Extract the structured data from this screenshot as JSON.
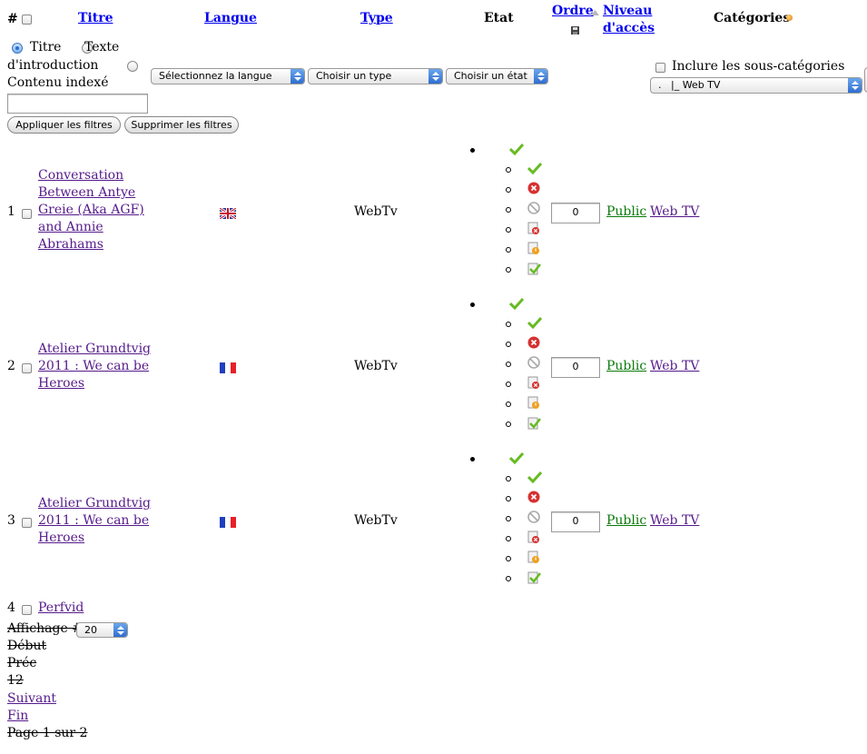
{
  "header": {
    "hash": "#",
    "titre": "Titre",
    "langue": "Langue",
    "type": "Type",
    "etat": "Etat",
    "ordre": "Ordre",
    "niveau_line1": "Niveau",
    "niveau_line2": "d'accès",
    "categories": "Catégories"
  },
  "filters": {
    "radio_titre": "Titre",
    "radio_texte_1": "Texte",
    "radio_texte_2": "d'introduction",
    "radio_contenu": "Contenu indexé",
    "search_value": "",
    "select_langue": "Sélectionnez la langue",
    "select_type": "Choisir un type",
    "select_etat": "Choisir un état",
    "include_sub": "Inclure les sous-catégories",
    "select_category": ".   |_ Web TV",
    "apply_label": "Appliquer les filtres",
    "clear_label": "Supprimer les filtres"
  },
  "rows": [
    {
      "num": "1",
      "title_lines": [
        "Conversation",
        "Between Antye",
        "Greie (Aka AGF)",
        "and Annie",
        "Abrahams"
      ],
      "lang": "uk",
      "type": "WebTv",
      "order": "0",
      "access": "Public",
      "category": "Web TV",
      "arrows": [
        "down"
      ]
    },
    {
      "num": "2",
      "title_lines": [
        "Atelier Grundtvig",
        "2011 : We can be",
        "Heroes"
      ],
      "lang": "fr",
      "type": "WebTv",
      "order": "0",
      "access": "Public",
      "category": "Web TV",
      "arrows": [
        "up",
        "down"
      ]
    },
    {
      "num": "3",
      "title_lines": [
        "Atelier Grundtvig",
        "2011 : We can be",
        "Heroes"
      ],
      "lang": "fr",
      "type": "WebTv",
      "order": "0",
      "access": "Public",
      "category": "Web TV",
      "arrows": [
        "up",
        "down"
      ]
    },
    {
      "num": "4",
      "title_lines": [
        "Perfvid"
      ]
    }
  ],
  "pagination": {
    "display_label": "Affichage #",
    "display_value": "20",
    "debut": "Début",
    "prec": "Préc",
    "pages": "12",
    "suivant": "Suivant",
    "fin": "Fin",
    "page_info": "Page 1 sur 2"
  },
  "colors": {
    "link_header": "#0000ee",
    "link_visited": "#551a8b",
    "link_green": "#0a7a0a",
    "check": "#66bb22",
    "unpublish": "#d83030"
  }
}
